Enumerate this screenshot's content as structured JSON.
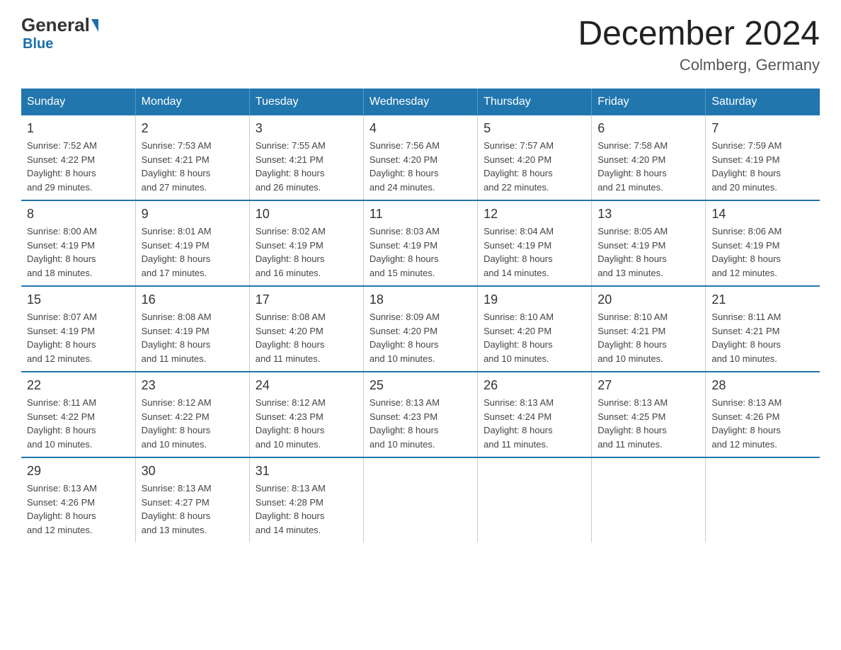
{
  "header": {
    "logo": {
      "general": "General",
      "blue": "Blue"
    },
    "title": "December 2024",
    "subtitle": "Colmberg, Germany"
  },
  "days_header": [
    "Sunday",
    "Monday",
    "Tuesday",
    "Wednesday",
    "Thursday",
    "Friday",
    "Saturday"
  ],
  "weeks": [
    [
      {
        "day": "1",
        "sunrise": "7:52 AM",
        "sunset": "4:22 PM",
        "daylight": "8 hours and 29 minutes."
      },
      {
        "day": "2",
        "sunrise": "7:53 AM",
        "sunset": "4:21 PM",
        "daylight": "8 hours and 27 minutes."
      },
      {
        "day": "3",
        "sunrise": "7:55 AM",
        "sunset": "4:21 PM",
        "daylight": "8 hours and 26 minutes."
      },
      {
        "day": "4",
        "sunrise": "7:56 AM",
        "sunset": "4:20 PM",
        "daylight": "8 hours and 24 minutes."
      },
      {
        "day": "5",
        "sunrise": "7:57 AM",
        "sunset": "4:20 PM",
        "daylight": "8 hours and 22 minutes."
      },
      {
        "day": "6",
        "sunrise": "7:58 AM",
        "sunset": "4:20 PM",
        "daylight": "8 hours and 21 minutes."
      },
      {
        "day": "7",
        "sunrise": "7:59 AM",
        "sunset": "4:19 PM",
        "daylight": "8 hours and 20 minutes."
      }
    ],
    [
      {
        "day": "8",
        "sunrise": "8:00 AM",
        "sunset": "4:19 PM",
        "daylight": "8 hours and 18 minutes."
      },
      {
        "day": "9",
        "sunrise": "8:01 AM",
        "sunset": "4:19 PM",
        "daylight": "8 hours and 17 minutes."
      },
      {
        "day": "10",
        "sunrise": "8:02 AM",
        "sunset": "4:19 PM",
        "daylight": "8 hours and 16 minutes."
      },
      {
        "day": "11",
        "sunrise": "8:03 AM",
        "sunset": "4:19 PM",
        "daylight": "8 hours and 15 minutes."
      },
      {
        "day": "12",
        "sunrise": "8:04 AM",
        "sunset": "4:19 PM",
        "daylight": "8 hours and 14 minutes."
      },
      {
        "day": "13",
        "sunrise": "8:05 AM",
        "sunset": "4:19 PM",
        "daylight": "8 hours and 13 minutes."
      },
      {
        "day": "14",
        "sunrise": "8:06 AM",
        "sunset": "4:19 PM",
        "daylight": "8 hours and 12 minutes."
      }
    ],
    [
      {
        "day": "15",
        "sunrise": "8:07 AM",
        "sunset": "4:19 PM",
        "daylight": "8 hours and 12 minutes."
      },
      {
        "day": "16",
        "sunrise": "8:08 AM",
        "sunset": "4:19 PM",
        "daylight": "8 hours and 11 minutes."
      },
      {
        "day": "17",
        "sunrise": "8:08 AM",
        "sunset": "4:20 PM",
        "daylight": "8 hours and 11 minutes."
      },
      {
        "day": "18",
        "sunrise": "8:09 AM",
        "sunset": "4:20 PM",
        "daylight": "8 hours and 10 minutes."
      },
      {
        "day": "19",
        "sunrise": "8:10 AM",
        "sunset": "4:20 PM",
        "daylight": "8 hours and 10 minutes."
      },
      {
        "day": "20",
        "sunrise": "8:10 AM",
        "sunset": "4:21 PM",
        "daylight": "8 hours and 10 minutes."
      },
      {
        "day": "21",
        "sunrise": "8:11 AM",
        "sunset": "4:21 PM",
        "daylight": "8 hours and 10 minutes."
      }
    ],
    [
      {
        "day": "22",
        "sunrise": "8:11 AM",
        "sunset": "4:22 PM",
        "daylight": "8 hours and 10 minutes."
      },
      {
        "day": "23",
        "sunrise": "8:12 AM",
        "sunset": "4:22 PM",
        "daylight": "8 hours and 10 minutes."
      },
      {
        "day": "24",
        "sunrise": "8:12 AM",
        "sunset": "4:23 PM",
        "daylight": "8 hours and 10 minutes."
      },
      {
        "day": "25",
        "sunrise": "8:13 AM",
        "sunset": "4:23 PM",
        "daylight": "8 hours and 10 minutes."
      },
      {
        "day": "26",
        "sunrise": "8:13 AM",
        "sunset": "4:24 PM",
        "daylight": "8 hours and 11 minutes."
      },
      {
        "day": "27",
        "sunrise": "8:13 AM",
        "sunset": "4:25 PM",
        "daylight": "8 hours and 11 minutes."
      },
      {
        "day": "28",
        "sunrise": "8:13 AM",
        "sunset": "4:26 PM",
        "daylight": "8 hours and 12 minutes."
      }
    ],
    [
      {
        "day": "29",
        "sunrise": "8:13 AM",
        "sunset": "4:26 PM",
        "daylight": "8 hours and 12 minutes."
      },
      {
        "day": "30",
        "sunrise": "8:13 AM",
        "sunset": "4:27 PM",
        "daylight": "8 hours and 13 minutes."
      },
      {
        "day": "31",
        "sunrise": "8:13 AM",
        "sunset": "4:28 PM",
        "daylight": "8 hours and 14 minutes."
      },
      null,
      null,
      null,
      null
    ]
  ],
  "labels": {
    "sunrise": "Sunrise:",
    "sunset": "Sunset:",
    "daylight": "Daylight:"
  }
}
